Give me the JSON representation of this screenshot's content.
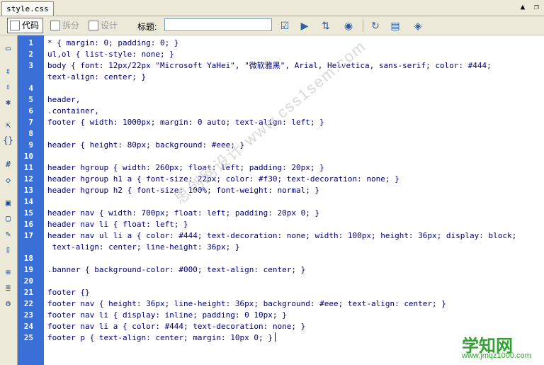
{
  "tab": {
    "filename": "style.css"
  },
  "window_controls": [
    "▲",
    "❐"
  ],
  "toolbar": {
    "view_code_label": "代码",
    "view_split_label": "拆分",
    "view_design_label": "设计",
    "title_label": "标题:",
    "title_value": ""
  },
  "code": {
    "line_numbers": [
      "1",
      "2",
      "3",
      "4",
      "5",
      "6",
      "7",
      "8",
      "9",
      "10",
      "11",
      "12",
      "13",
      "14",
      "15",
      "16",
      "17",
      "18",
      "19",
      "20",
      "21",
      "22",
      "23",
      "24",
      "25"
    ],
    "lines": [
      "* { margin: 0; padding: 0; }",
      "ul,ol { list-style: none; }",
      "body { font: 12px/22px \"Microsoft YaHei\", \"微软雅黑\", Arial, Helvetica, sans-serif; color: #444;",
      "text-align: center; }",
      "",
      "header,",
      ".container,",
      "footer { width: 1000px; margin: 0 auto; text-align: left; }",
      "",
      "header { height: 80px; background: #eee; }",
      "",
      "header hgroup { width: 260px; float: left; padding: 20px; }",
      "header hgroup h1 a { font-size: 22px; color: #f30; text-decoration: none; }",
      "header hgroup h2 { font-size: 100%; font-weight: normal; }",
      "",
      "header nav { width: 700px; float: left; padding: 20px 0; }",
      "header nav li { float: left; }",
      "header nav ul li a { color: #444; text-decoration: none; width: 100px; height: 36px; display: block;",
      " text-align: center; line-height: 36px; }",
      "",
      ".banner { background-color: #000; text-align: center; }",
      "",
      "footer {}",
      "footer nav { height: 36px; line-height: 36px; background: #eee; text-align: center; }",
      "footer nav li { display: inline; padding: 0 10px; }",
      "footer nav li a { color: #444; text-decoration: none; }",
      "footer p { text-align: center; margin: 10px 0; }"
    ]
  },
  "watermarks": {
    "diagonal": "思创网设计 www.css1sem.com",
    "brand": "学知网",
    "brand_url": "www.jmqz1000.com"
  },
  "colors": {
    "gutter": "#3a6fd8",
    "selector": "#ff00ff",
    "code_text": "#000080"
  }
}
